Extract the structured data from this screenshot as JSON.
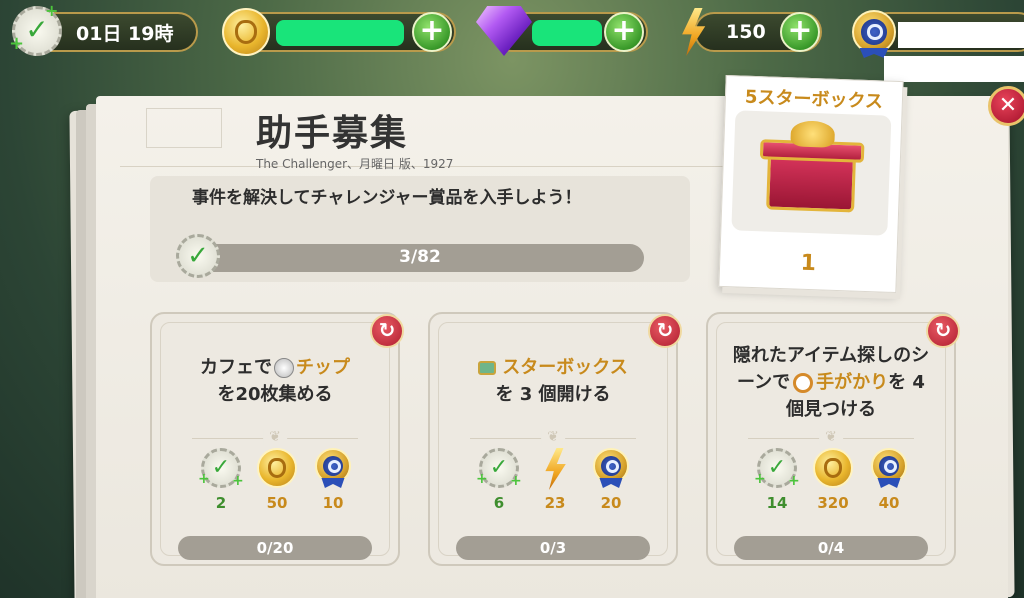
{
  "topbar": {
    "timer": "01日 19時",
    "energy": "150"
  },
  "panel": {
    "title": "助手募集",
    "subtitle": "The Challenger、月曜日 版、1927",
    "mission_text": "事件を解決してチャレンジャー賞品を入手しよう！",
    "progress_label": "3/82",
    "progress_fraction": 0.037
  },
  "reward": {
    "title": "5スターボックス",
    "count": "1"
  },
  "tasks": [
    {
      "text_a": "カフェで",
      "text_hl": "チップ",
      "text_b": "を20枚集める",
      "rewards": [
        "2",
        "50",
        "10"
      ],
      "progress": "0/20"
    },
    {
      "text_hl": "スターボックス",
      "text_b": "を 3 個開ける",
      "rewards": [
        "6",
        "23",
        "20"
      ],
      "progress": "0/3"
    },
    {
      "text_a": "隠れたアイテム探しのシーンで",
      "text_hl": "手がかり",
      "text_b": "を 4 個見つける",
      "rewards": [
        "14",
        "320",
        "40"
      ],
      "progress": "0/4"
    }
  ]
}
